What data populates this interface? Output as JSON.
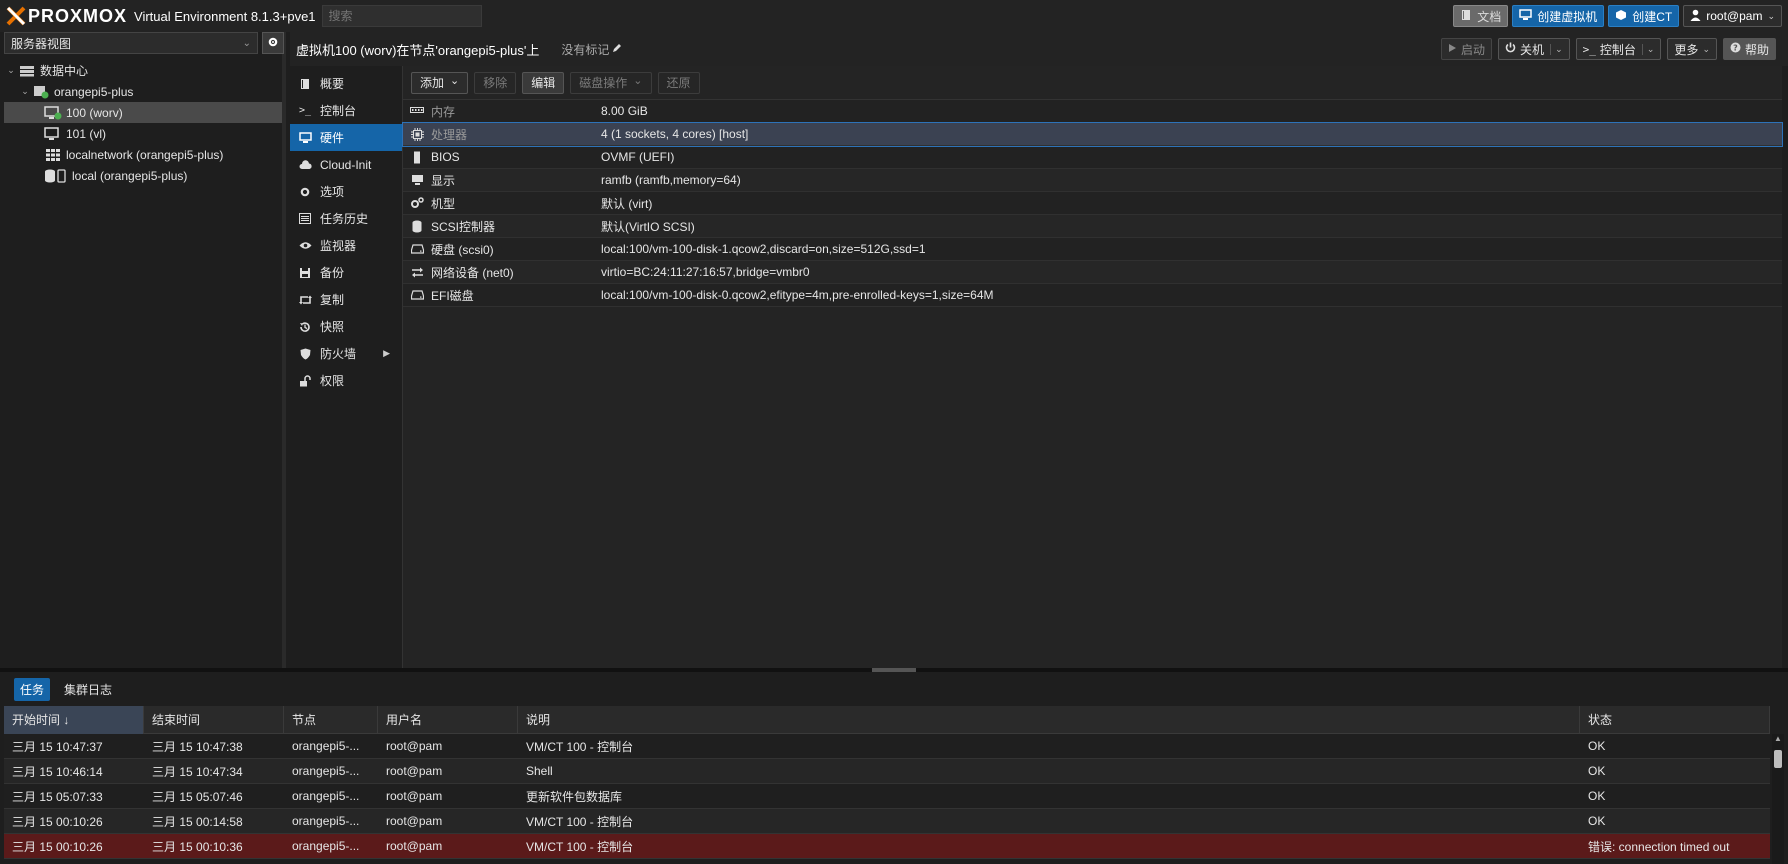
{
  "brand": {
    "logo_text": "PROXMOX",
    "version": "Virtual Environment 8.1.3+pve1"
  },
  "search": {
    "placeholder": "搜索"
  },
  "topbar": {
    "docs_label": "文档",
    "create_vm_label": "创建虚拟机",
    "create_ct_label": "创建CT",
    "user_label": "root@pam"
  },
  "left": {
    "view_select": "服务器视图",
    "tree": [
      {
        "label": "数据中心",
        "icon": "datacenter-icon"
      },
      {
        "label": "orangepi5-plus",
        "icon": "node-icon"
      },
      {
        "label": "100 (worv)",
        "icon": "vm-running-icon"
      },
      {
        "label": "101 (vl)",
        "icon": "vm-icon"
      },
      {
        "label": "localnetwork (orangepi5-plus)",
        "icon": "network-icon"
      },
      {
        "label": "local (orangepi5-plus)",
        "icon": "storage-icon"
      }
    ]
  },
  "header": {
    "title": "虚拟机100 (worv)在节点'orangepi5-plus'上",
    "tags": "没有标记",
    "start_label": "启动",
    "shutdown_label": "关机",
    "console_label": "控制台",
    "more_label": "更多",
    "help_label": "帮助"
  },
  "submenu": [
    {
      "label": "概要",
      "icon": "book-icon"
    },
    {
      "label": "控制台",
      "icon": "terminal-icon"
    },
    {
      "label": "硬件",
      "icon": "monitor-icon"
    },
    {
      "label": "Cloud-Init",
      "icon": "cloud-icon"
    },
    {
      "label": "选项",
      "icon": "gear-icon"
    },
    {
      "label": "任务历史",
      "icon": "list-icon"
    },
    {
      "label": "监视器",
      "icon": "eye-icon"
    },
    {
      "label": "备份",
      "icon": "floppy-icon"
    },
    {
      "label": "复制",
      "icon": "retweet-icon"
    },
    {
      "label": "快照",
      "icon": "history-icon"
    },
    {
      "label": "防火墙",
      "icon": "shield-icon"
    },
    {
      "label": "权限",
      "icon": "unlock-icon"
    }
  ],
  "toolbar": {
    "add_label": "添加",
    "remove_label": "移除",
    "edit_label": "编辑",
    "disk_action_label": "磁盘操作",
    "revert_label": "还原"
  },
  "hardware": [
    {
      "key": "内存",
      "value": "8.00 GiB",
      "icon": "memory-icon"
    },
    {
      "key": "处理器",
      "value": "4 (1 sockets, 4 cores) [host]",
      "icon": "cpu-icon"
    },
    {
      "key": "BIOS",
      "value": "OVMF (UEFI)",
      "icon": "microchip-icon"
    },
    {
      "key": "显示",
      "value": "ramfb (ramfb,memory=64)",
      "icon": "desktop-icon"
    },
    {
      "key": "机型",
      "value": "默认 (virt)",
      "icon": "cogs-icon"
    },
    {
      "key": "SCSI控制器",
      "value": "默认(VirtIO SCSI)",
      "icon": "database-icon"
    },
    {
      "key": "硬盘 (scsi0)",
      "value": "local:100/vm-100-disk-1.qcow2,discard=on,size=512G,ssd=1",
      "icon": "hdd-icon"
    },
    {
      "key": "网络设备 (net0)",
      "value": "virtio=BC:24:11:27:16:57,bridge=vmbr0",
      "icon": "exchange-icon"
    },
    {
      "key": "EFI磁盘",
      "value": "local:100/vm-100-disk-0.qcow2,efitype=4m,pre-enrolled-keys=1,size=64M",
      "icon": "hdd-icon"
    }
  ],
  "bottom": {
    "tab_tasks": "任务",
    "tab_cluster_log": "集群日志",
    "columns": [
      "开始时间 ↓",
      "结束时间",
      "节点",
      "用户名",
      "说明",
      "状态"
    ],
    "rows": [
      {
        "start": "三月 15 10:47:37",
        "end": "三月 15 10:47:38",
        "node": "orangepi5-...",
        "user": "root@pam",
        "desc": "VM/CT 100 - 控制台",
        "status": "OK"
      },
      {
        "start": "三月 15 10:46:14",
        "end": "三月 15 10:47:34",
        "node": "orangepi5-...",
        "user": "root@pam",
        "desc": "Shell",
        "status": "OK"
      },
      {
        "start": "三月 15 05:07:33",
        "end": "三月 15 05:07:46",
        "node": "orangepi5-...",
        "user": "root@pam",
        "desc": "更新软件包数据库",
        "status": "OK"
      },
      {
        "start": "三月 15 00:10:26",
        "end": "三月 15 00:14:58",
        "node": "orangepi5-...",
        "user": "root@pam",
        "desc": "VM/CT 100 - 控制台",
        "status": "OK"
      },
      {
        "start": "三月 15 00:10:26",
        "end": "三月 15 00:10:36",
        "node": "orangepi5-...",
        "user": "root@pam",
        "desc": "VM/CT 100 - 控制台",
        "status": "错误: connection timed out"
      }
    ]
  },
  "colors": {
    "accent": "#1565a8",
    "error_row": "#5b1a1a",
    "running_green": "#4caf50"
  }
}
